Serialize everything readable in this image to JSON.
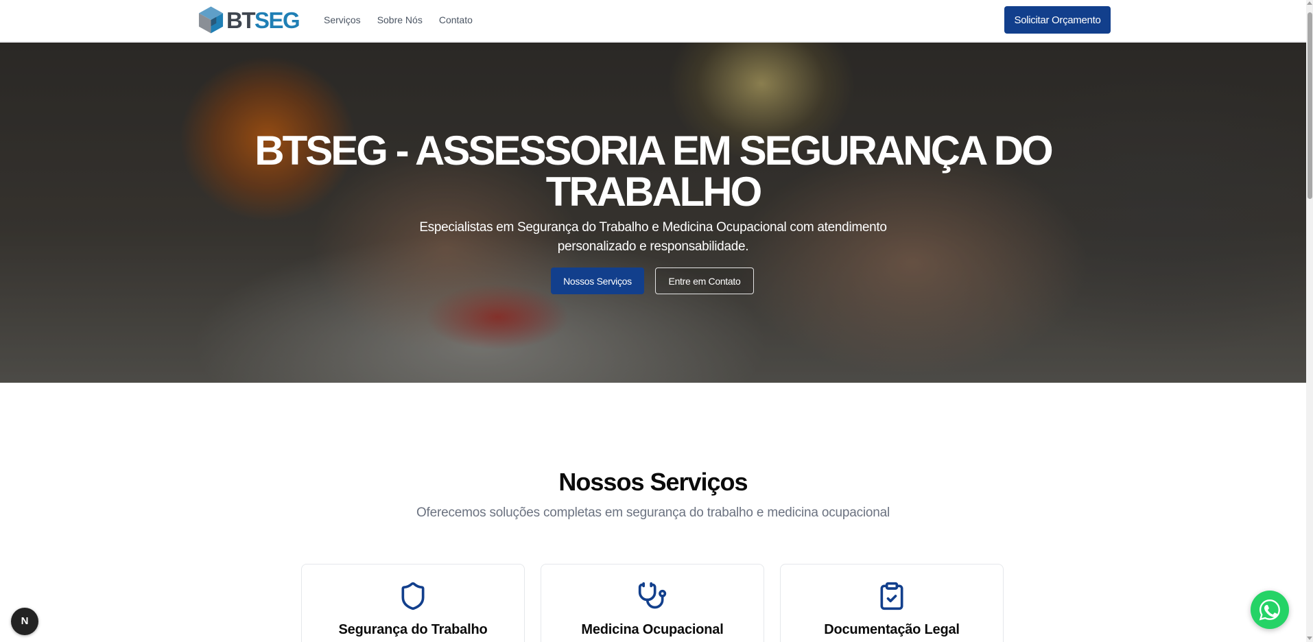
{
  "header": {
    "logo": {
      "part1": "BT",
      "part2": "SEG"
    },
    "nav": [
      {
        "label": "Serviços"
      },
      {
        "label": "Sobre Nós"
      },
      {
        "label": "Contato"
      }
    ],
    "cta_label": "Solicitar Orçamento"
  },
  "hero": {
    "title": "BTSEG - ASSESSORIA EM SEGURANÇA DO TRABALHO",
    "subtitle": "Especialistas em Segurança do Trabalho e Medicina Ocupacional com atendimento personalizado e responsabilidade.",
    "primary_button": "Nossos Serviços",
    "secondary_button": "Entre em Contato"
  },
  "services": {
    "title": "Nossos Serviços",
    "subtitle": "Oferecemos soluções completas em segurança do trabalho e medicina ocupacional",
    "cards": [
      {
        "title": "Segurança do Trabalho",
        "icon": "shield-icon"
      },
      {
        "title": "Medicina Ocupacional",
        "icon": "stethoscope-icon"
      },
      {
        "title": "Documentação Legal",
        "icon": "clipboard-check-icon"
      }
    ]
  },
  "floating": {
    "dev_badge": "N",
    "whatsapp_icon": "whatsapp-icon"
  },
  "colors": {
    "brand_blue": "#123f8c",
    "logo_blue": "#1f7fb5",
    "logo_gray": "#3f4650",
    "whatsapp_green": "#25d366"
  }
}
